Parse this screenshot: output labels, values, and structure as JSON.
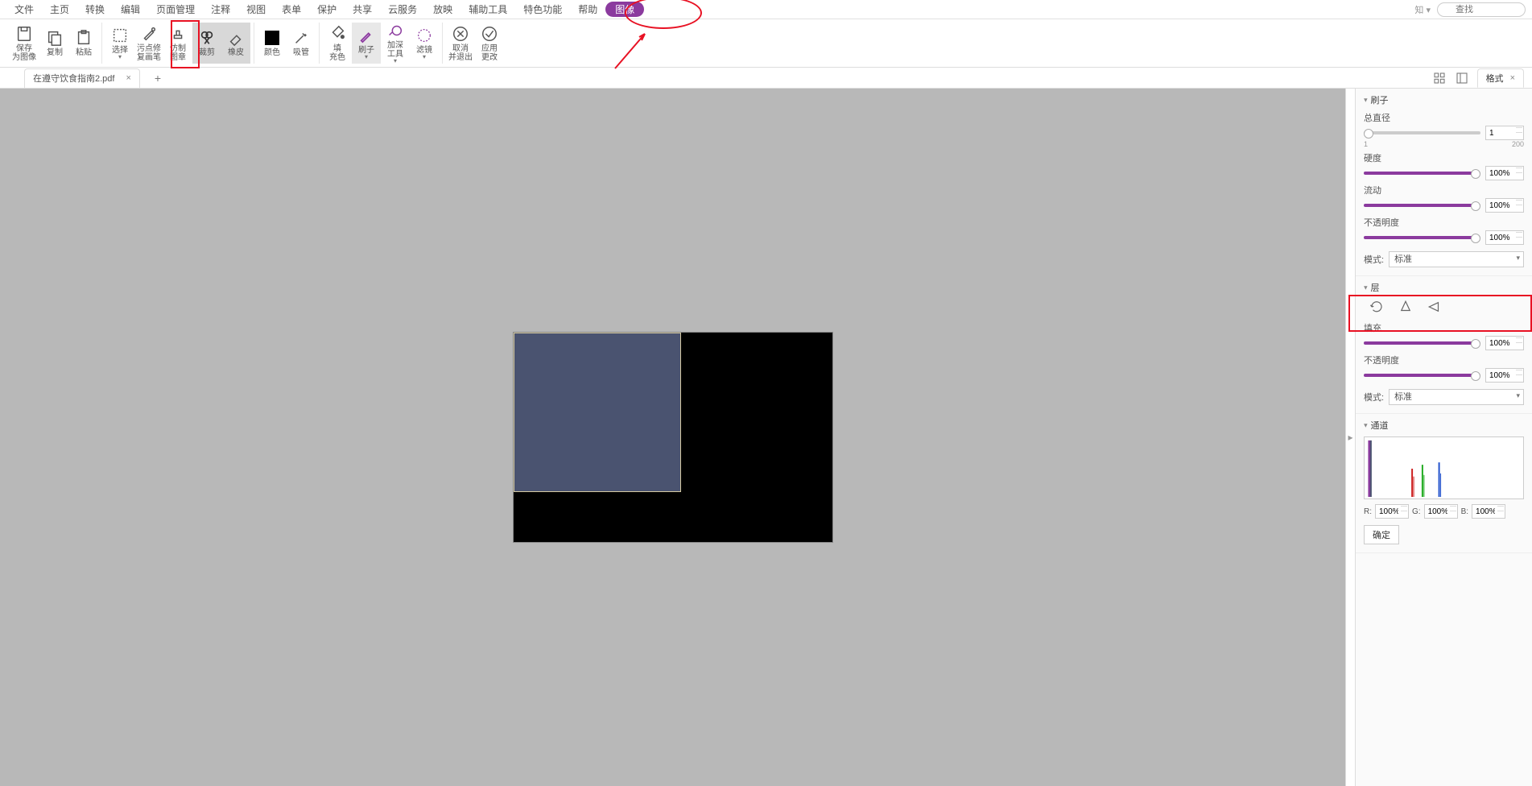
{
  "menu": {
    "items": [
      "文件",
      "主页",
      "转换",
      "编辑",
      "页面管理",
      "注释",
      "视图",
      "表单",
      "保护",
      "共享",
      "云服务",
      "放映",
      "辅助工具",
      "特色功能",
      "帮助",
      "图像"
    ],
    "active_index": 15,
    "zhi_label": "知 ▾",
    "search_placeholder": "查找"
  },
  "toolbar": {
    "g1": [
      {
        "label": "保存\n为图像",
        "name": "save-as-image"
      },
      {
        "label": "复制",
        "name": "copy"
      },
      {
        "label": "粘贴",
        "name": "paste"
      }
    ],
    "g2": [
      {
        "label": "选择",
        "name": "select",
        "dd": true
      },
      {
        "label": "污点修\n复画笔",
        "name": "spot-heal"
      },
      {
        "label": "仿制\n图章",
        "name": "clone-stamp"
      },
      {
        "label": "裁剪",
        "name": "crop",
        "selected": true
      },
      {
        "label": "橡皮",
        "name": "eraser",
        "selected": true
      }
    ],
    "g3": [
      {
        "label": "颜色",
        "name": "color"
      },
      {
        "label": "吸管",
        "name": "eyedropper"
      }
    ],
    "g4": [
      {
        "label": "填\n充色",
        "name": "fill"
      },
      {
        "label": "刷子",
        "name": "brush",
        "selected2": true,
        "dd": true
      },
      {
        "label": "加深\n工具",
        "name": "burn",
        "dd": true
      },
      {
        "label": "滤镜",
        "name": "filter",
        "dd": true
      }
    ],
    "g5": [
      {
        "label": "取消\n并退出",
        "name": "cancel-exit"
      },
      {
        "label": "应用\n更改",
        "name": "apply-changes"
      }
    ]
  },
  "tabs": {
    "file_name": "在遵守饮食指南2.pdf",
    "format_tab": "格式"
  },
  "panel": {
    "brush_section": "刷子",
    "diameter_label": "总直径",
    "diameter_value": "1",
    "diameter_min": "1",
    "diameter_max": "200",
    "hardness_label": "硬度",
    "hardness_value": "100%",
    "flow_label": "流动",
    "flow_value": "100%",
    "opacity_label": "不透明度",
    "opacity_value": "100%",
    "mode_label": "模式:",
    "mode_value": "标准",
    "layer_section": "层",
    "fill_label": "填充",
    "fill_value": "100%",
    "layer_opacity_label": "不透明度",
    "layer_opacity_value": "100%",
    "layer_mode_label": "模式:",
    "layer_mode_value": "标准",
    "channel_section": "通道",
    "r_label": "R:",
    "r_value": "100%",
    "g_label": "G:",
    "g_value": "100%",
    "b_label": "B:",
    "b_value": "100%",
    "confirm_label": "确定"
  }
}
